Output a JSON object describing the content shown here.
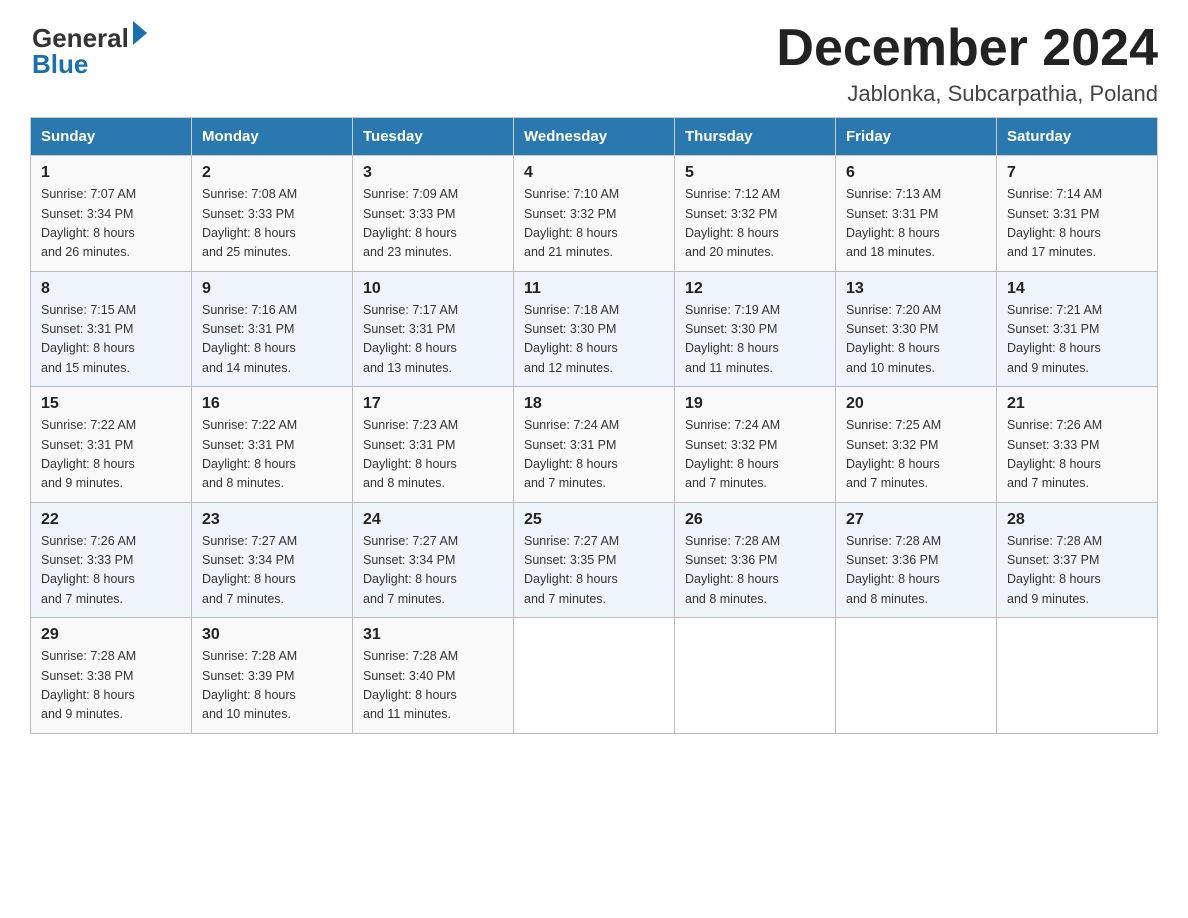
{
  "header": {
    "logo_general": "General",
    "logo_blue": "Blue",
    "month_title": "December 2024",
    "location": "Jablonka, Subcarpathia, Poland"
  },
  "weekdays": [
    "Sunday",
    "Monday",
    "Tuesday",
    "Wednesday",
    "Thursday",
    "Friday",
    "Saturday"
  ],
  "weeks": [
    [
      {
        "day": "1",
        "sunrise": "7:07 AM",
        "sunset": "3:34 PM",
        "daylight": "8 hours and 26 minutes."
      },
      {
        "day": "2",
        "sunrise": "7:08 AM",
        "sunset": "3:33 PM",
        "daylight": "8 hours and 25 minutes."
      },
      {
        "day": "3",
        "sunrise": "7:09 AM",
        "sunset": "3:33 PM",
        "daylight": "8 hours and 23 minutes."
      },
      {
        "day": "4",
        "sunrise": "7:10 AM",
        "sunset": "3:32 PM",
        "daylight": "8 hours and 21 minutes."
      },
      {
        "day": "5",
        "sunrise": "7:12 AM",
        "sunset": "3:32 PM",
        "daylight": "8 hours and 20 minutes."
      },
      {
        "day": "6",
        "sunrise": "7:13 AM",
        "sunset": "3:31 PM",
        "daylight": "8 hours and 18 minutes."
      },
      {
        "day": "7",
        "sunrise": "7:14 AM",
        "sunset": "3:31 PM",
        "daylight": "8 hours and 17 minutes."
      }
    ],
    [
      {
        "day": "8",
        "sunrise": "7:15 AM",
        "sunset": "3:31 PM",
        "daylight": "8 hours and 15 minutes."
      },
      {
        "day": "9",
        "sunrise": "7:16 AM",
        "sunset": "3:31 PM",
        "daylight": "8 hours and 14 minutes."
      },
      {
        "day": "10",
        "sunrise": "7:17 AM",
        "sunset": "3:31 PM",
        "daylight": "8 hours and 13 minutes."
      },
      {
        "day": "11",
        "sunrise": "7:18 AM",
        "sunset": "3:30 PM",
        "daylight": "8 hours and 12 minutes."
      },
      {
        "day": "12",
        "sunrise": "7:19 AM",
        "sunset": "3:30 PM",
        "daylight": "8 hours and 11 minutes."
      },
      {
        "day": "13",
        "sunrise": "7:20 AM",
        "sunset": "3:30 PM",
        "daylight": "8 hours and 10 minutes."
      },
      {
        "day": "14",
        "sunrise": "7:21 AM",
        "sunset": "3:31 PM",
        "daylight": "8 hours and 9 minutes."
      }
    ],
    [
      {
        "day": "15",
        "sunrise": "7:22 AM",
        "sunset": "3:31 PM",
        "daylight": "8 hours and 9 minutes."
      },
      {
        "day": "16",
        "sunrise": "7:22 AM",
        "sunset": "3:31 PM",
        "daylight": "8 hours and 8 minutes."
      },
      {
        "day": "17",
        "sunrise": "7:23 AM",
        "sunset": "3:31 PM",
        "daylight": "8 hours and 8 minutes."
      },
      {
        "day": "18",
        "sunrise": "7:24 AM",
        "sunset": "3:31 PM",
        "daylight": "8 hours and 7 minutes."
      },
      {
        "day": "19",
        "sunrise": "7:24 AM",
        "sunset": "3:32 PM",
        "daylight": "8 hours and 7 minutes."
      },
      {
        "day": "20",
        "sunrise": "7:25 AM",
        "sunset": "3:32 PM",
        "daylight": "8 hours and 7 minutes."
      },
      {
        "day": "21",
        "sunrise": "7:26 AM",
        "sunset": "3:33 PM",
        "daylight": "8 hours and 7 minutes."
      }
    ],
    [
      {
        "day": "22",
        "sunrise": "7:26 AM",
        "sunset": "3:33 PM",
        "daylight": "8 hours and 7 minutes."
      },
      {
        "day": "23",
        "sunrise": "7:27 AM",
        "sunset": "3:34 PM",
        "daylight": "8 hours and 7 minutes."
      },
      {
        "day": "24",
        "sunrise": "7:27 AM",
        "sunset": "3:34 PM",
        "daylight": "8 hours and 7 minutes."
      },
      {
        "day": "25",
        "sunrise": "7:27 AM",
        "sunset": "3:35 PM",
        "daylight": "8 hours and 7 minutes."
      },
      {
        "day": "26",
        "sunrise": "7:28 AM",
        "sunset": "3:36 PM",
        "daylight": "8 hours and 8 minutes."
      },
      {
        "day": "27",
        "sunrise": "7:28 AM",
        "sunset": "3:36 PM",
        "daylight": "8 hours and 8 minutes."
      },
      {
        "day": "28",
        "sunrise": "7:28 AM",
        "sunset": "3:37 PM",
        "daylight": "8 hours and 9 minutes."
      }
    ],
    [
      {
        "day": "29",
        "sunrise": "7:28 AM",
        "sunset": "3:38 PM",
        "daylight": "8 hours and 9 minutes."
      },
      {
        "day": "30",
        "sunrise": "7:28 AM",
        "sunset": "3:39 PM",
        "daylight": "8 hours and 10 minutes."
      },
      {
        "day": "31",
        "sunrise": "7:28 AM",
        "sunset": "3:40 PM",
        "daylight": "8 hours and 11 minutes."
      },
      null,
      null,
      null,
      null
    ]
  ],
  "labels": {
    "sunrise": "Sunrise:",
    "sunset": "Sunset:",
    "daylight": "Daylight:"
  }
}
